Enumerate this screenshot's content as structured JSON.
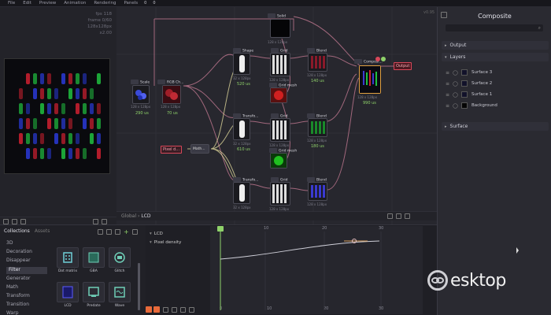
{
  "menu": {
    "items": [
      "File",
      "Edit",
      "Preview",
      "Animation",
      "Rendering",
      "Panels"
    ],
    "counter_a": "0",
    "counter_b": "0"
  },
  "version": "v0.95",
  "preview": {
    "info": [
      "fps 118",
      "frame 0/60",
      "128x128px",
      "x2.00"
    ]
  },
  "graph": {
    "breadcrumb_root": "Global",
    "breadcrumb_current": "LCD",
    "nodes": {
      "scale": {
        "title": "Scale",
        "dim": "128 x 128px",
        "time": "290 us"
      },
      "rgb": {
        "title": "RGB Ch...",
        "dim": "128 x 128px",
        "time": "70 us"
      },
      "solid": {
        "title": "Solid",
        "dim": "128 x 128px"
      },
      "shape1": {
        "title": "Shape",
        "dim": "32 x 128px",
        "time": "520 us"
      },
      "grid1": {
        "title": "Grid",
        "dim": "128 x 128px"
      },
      "blend1": {
        "title": "Blend",
        "dim": "128 x 128px",
        "time": "140 us"
      },
      "transform1": {
        "title": "Transfo...",
        "dim": "32 x 128px",
        "time": "610 us"
      },
      "grid2": {
        "title": "Grid",
        "dim": "128 x 128px"
      },
      "blend2": {
        "title": "Blend",
        "dim": "128 x 128px",
        "time": "180 us"
      },
      "transform2": {
        "title": "Transfo...",
        "dim": "32 x 128px"
      },
      "grid3": {
        "title": "Grid",
        "dim": "128 x 128px"
      },
      "blend3": {
        "title": "Blend",
        "dim": "128 x 128px"
      },
      "grid_mesh1": {
        "title": "Grid mesh"
      },
      "grid_mesh2": {
        "title": "Grid mesh"
      },
      "composite": {
        "title": "Composi...",
        "dim": "128 x 128px",
        "time": "990 us"
      },
      "math": {
        "title": "Math..."
      }
    },
    "tags": {
      "pixel": "Pixel d...",
      "output": "Output"
    }
  },
  "inspector": {
    "title": "Composite",
    "sections": {
      "output": "Output",
      "layers": "Layers",
      "surface": "Surface"
    },
    "layers": [
      "Surface 3",
      "Surface 2",
      "Surface 1",
      "Background"
    ]
  },
  "collections": {
    "tab_active": "Collections",
    "tab_other": "Assets",
    "items": [
      "3D",
      "Decoration",
      "Disappear",
      "Filter",
      "Generator",
      "Math",
      "Transform",
      "Transition",
      "Warp"
    ],
    "tiles": [
      "Dot matrix",
      "GBA",
      "Glitch",
      "LCD",
      "Predate",
      "Wave"
    ]
  },
  "animation": {
    "group": "LCD",
    "track": "Pixel density",
    "ticks_top": [
      "0",
      "10",
      "20",
      "30"
    ],
    "ticks_bottom": [
      "0",
      "10",
      "20",
      "30"
    ]
  },
  "watermark": "esktop",
  "colors": {
    "accent_green": "#8fd26a",
    "accent_red": "#d8485a"
  }
}
